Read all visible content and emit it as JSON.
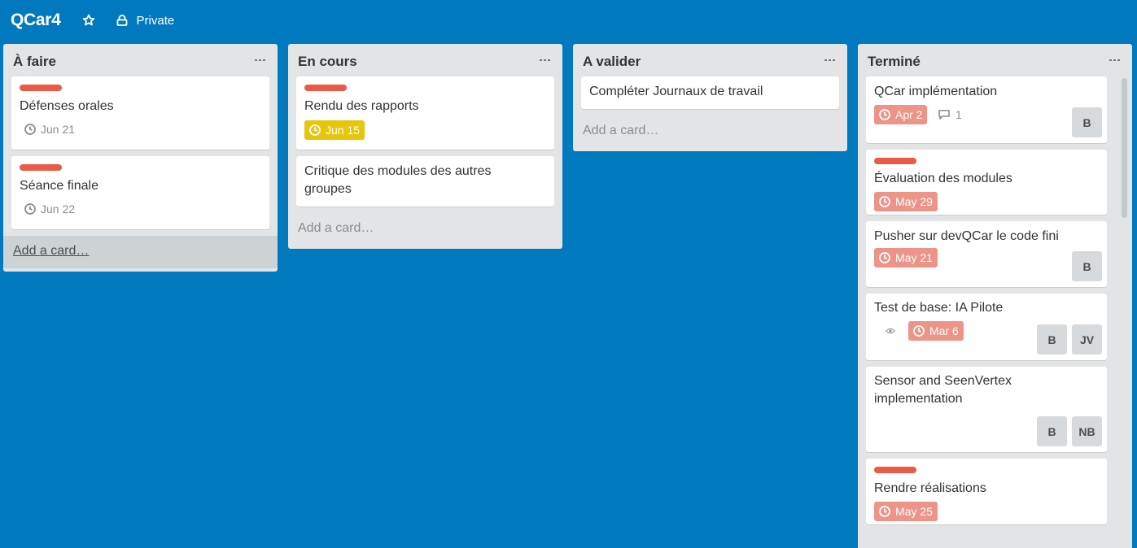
{
  "board": {
    "title": "QCar4",
    "visibility": "Private",
    "star_icon": "star-outline",
    "visibility_icon": "lock"
  },
  "colors": {
    "board_bg": "#0079bf",
    "list_bg": "#e2e4e6",
    "label_red": "#eb5a46",
    "due_soon_yellow": "#e6c60d",
    "past_due_red": "#ec9488"
  },
  "lists": [
    {
      "title": "À faire",
      "cards": [
        {
          "label_color": "red",
          "title": "Défenses orales",
          "due": "Jun 21"
        },
        {
          "label_color": "red",
          "title": "Séance finale",
          "due": "Jun 22"
        }
      ],
      "add_card": "Add a card…"
    },
    {
      "title": "En cours",
      "cards": [
        {
          "label_color": "red",
          "title": "Rendu des rapports",
          "due": "Jun 15",
          "due_status": "due-soon"
        },
        {
          "title": "Critique des modules des autres groupes"
        }
      ],
      "add_card": "Add a card…"
    },
    {
      "title": "A valider",
      "cards": [
        {
          "title": "Compléter Journaux de travail"
        }
      ],
      "add_card": "Add a card…"
    },
    {
      "title": "Terminé",
      "cards": [
        {
          "title": "QCar implémentation",
          "due": "Apr 2",
          "due_status": "past-due",
          "comments": "1",
          "members": [
            "B"
          ]
        },
        {
          "label_color": "red",
          "title": "Évaluation des modules",
          "due": "May 29",
          "due_status": "past-due"
        },
        {
          "title": "Pusher sur devQCar le code fini",
          "due": "May 21",
          "due_status": "past-due",
          "members": [
            "B"
          ]
        },
        {
          "title": "Test de base: IA Pilote",
          "watching": true,
          "due": "Mar 6",
          "due_status": "past-due",
          "members": [
            "B",
            "JV"
          ]
        },
        {
          "title": "Sensor and SeenVertex implementation",
          "members": [
            "B",
            "NB"
          ]
        },
        {
          "label_color": "red",
          "title": "Rendre réalisations",
          "due": "May 25",
          "due_status": "past-due"
        }
      ]
    }
  ]
}
